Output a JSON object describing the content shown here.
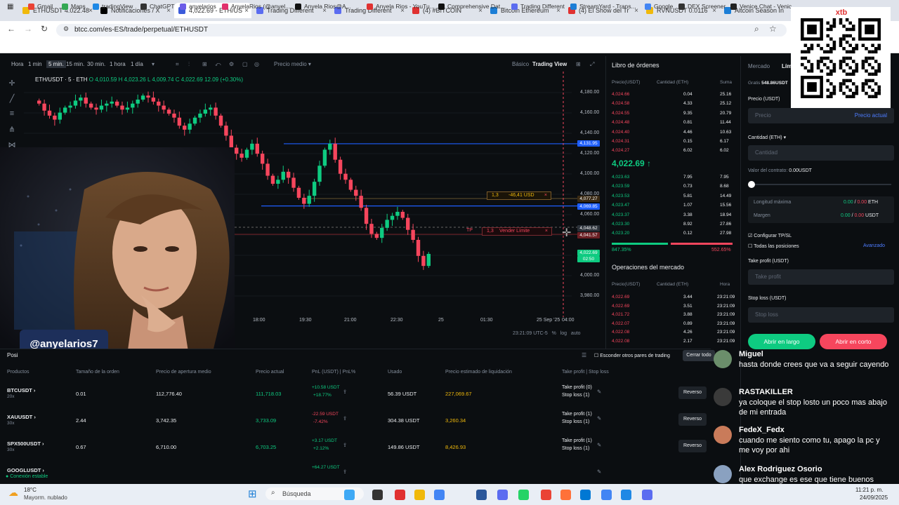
{
  "tabs": [
    {
      "label": "ETHUSDT 4.022.48",
      "color": "#f0b90b"
    },
    {
      "label": "Notificaciones / X",
      "color": "#000000"
    },
    {
      "label": "4,022.69 - ETH/US",
      "color": "#3b5bdb",
      "active": true
    },
    {
      "label": "Trading Different",
      "color": "#5b6cf0"
    },
    {
      "label": "Trading Different",
      "color": "#5b6cf0"
    },
    {
      "label": "(4) #BITCOIN",
      "color": "#e03131"
    },
    {
      "label": "Bitcoin Ethereum",
      "color": "#1c7ed6"
    },
    {
      "label": "(4) El Show del Tr",
      "color": "#e03131"
    },
    {
      "label": "RVNUSDT 0.0116",
      "color": "#f0b90b"
    },
    {
      "label": "Altcoin Season In",
      "color": "#1c7ed6"
    }
  ],
  "url": "btcc.com/es-ES/trade/perpetual/ETHUSDT",
  "bookmarks": [
    "Gmail",
    "Maps",
    "tradingView",
    "ChatGPT",
    "anyelarios",
    "AnyelaRios (@anyel...",
    "Anyela Rios@A...",
    "Anyela Rios - YouTu...",
    "Comprehensive Dat...",
    "Trading Different",
    "StreamYard - Trans...",
    "Google",
    "DEX Screener",
    "Venice Chat - Venic..."
  ],
  "chart_toolbar": {
    "interval_label": "Hora",
    "intervals": [
      "1 min",
      "5 min.",
      "15 min.",
      "30 min.",
      "1 hora",
      "1 día"
    ],
    "active_interval": "5 min.",
    "price_mode": "Precio medio",
    "view_basic": "Básico",
    "view_trading": "Trading View"
  },
  "symbol_line": {
    "symbol": "ETH/USDT · 5 · ETH",
    "o": "O 4,010.59",
    "h": "H 4,023.26",
    "l": "L 4,009.74",
    "c": "C 4,022.69",
    "chg": "12.09 (+0.30%)"
  },
  "price_scale": [
    "4,180.00",
    "4,160.00",
    "4,140.00",
    "4,120.00",
    "4,100.00",
    "4,080.00",
    "4,060.00",
    "4,040.00",
    "4,020.00",
    "4,000.00",
    "3,980.00"
  ],
  "price_tags": [
    {
      "v": "4,131.95",
      "c": "#1e5eff"
    },
    {
      "v": "4,077.27",
      "c": "#3a2a14"
    },
    {
      "v": "4,069.85",
      "c": "#1e5eff"
    },
    {
      "v": "4,048.62",
      "c": "#2b3139"
    },
    {
      "v": "4,041.57",
      "c": "#6b1f24"
    },
    {
      "v": "4,022.69",
      "c": "#0ecb81"
    },
    {
      "v": "02:50",
      "c": "#0ecb81"
    }
  ],
  "order_labels": {
    "sl": "1,3",
    "sl_val": "-46,41 USD",
    "tp": "TP",
    "tp_qty": "1,3",
    "tp_text": "Vender Límite"
  },
  "time_axis": [
    "18:00",
    "19:30",
    "21:00",
    "22:30",
    "25",
    "01:30",
    "25 Sep '25",
    "04:00"
  ],
  "chart_footer": {
    "clock": "23:21:09 UTC-5",
    "pct": "%",
    "log": "log",
    "auto": "auto"
  },
  "handle": "@anyelarios7",
  "orderbook": {
    "title": "Libro de órdenes",
    "cols": [
      "Precio(USDT)",
      "Cantidad (ETH)",
      "Suma"
    ],
    "asks": [
      [
        "4,024.66",
        "0.04",
        "25.16"
      ],
      [
        "4,024.58",
        "4.33",
        "25.12"
      ],
      [
        "4,024.55",
        "9.35",
        "20.79"
      ],
      [
        "4,024.48",
        "0.81",
        "11.44"
      ],
      [
        "4,024.40",
        "4.46",
        "10.63"
      ],
      [
        "4,024.31",
        "0.15",
        "6.17"
      ],
      [
        "4,024.27",
        "6.02",
        "6.02"
      ]
    ],
    "last": "4,022.69",
    "bids": [
      [
        "4,023.63",
        "7.95",
        "7.95"
      ],
      [
        "4,023.59",
        "0.73",
        "8.68"
      ],
      [
        "4,023.53",
        "5.81",
        "14.49"
      ],
      [
        "4,023.47",
        "1.07",
        "15.56"
      ],
      [
        "4,023.37",
        "3.38",
        "18.94"
      ],
      [
        "4,023.30",
        "8.92",
        "27.86"
      ],
      [
        "4,023.20",
        "0.12",
        "27.98"
      ]
    ],
    "buy_pct": "847.35%",
    "sell_pct": "552.65%",
    "trades_title": "Operaciones del mercado",
    "trades_cols": [
      "Precio(USDT)",
      "Cantidad (ETH)",
      "Hora"
    ],
    "trades": [
      [
        "4,022.69",
        "3.44",
        "23:21:09"
      ],
      [
        "4,022.69",
        "3.51",
        "23:21:09"
      ],
      [
        "4,021.72",
        "3.88",
        "23:21:09"
      ],
      [
        "4,022.07",
        "0.89",
        "23:21:09"
      ],
      [
        "4,022.08",
        "4.26",
        "23:21:09"
      ],
      [
        "4,022.08",
        "2.17",
        "23:21:09"
      ]
    ]
  },
  "trade_panel": {
    "tab_market": "Mercado",
    "tab_limit": "Lími",
    "grats": "Gratis",
    "balance": "548.86USDT",
    "price_label": "Precio (USDT)",
    "price_ph": "Precio",
    "price_current": "Precio actual",
    "qty_label": "Cantidad (ETH)",
    "qty_ph": "Cantidad",
    "contract_value": "Valor del contrato:",
    "contract_num": "0.00USDT",
    "max_len": "Longitud máxima",
    "max_len_v1": "0.00",
    "max_len_v2": "0.00",
    "max_len_unit": "ETH",
    "margin": "Margen",
    "margin_v1": "0.00",
    "margin_v2": "0.00",
    "margin_unit": "USDT",
    "cfg_tpsl": "Configurar TP/SL",
    "all_pos": "Todas las posiciones",
    "advanced": "Avanzado",
    "tp_label": "Take profit (USDT)",
    "tp_ph": "Take profit",
    "sl_label": "Stop loss (USDT)",
    "sl_ph": "Stop loss",
    "btn_long": "Abrir en largo",
    "btn_short": "Abrir en corto"
  },
  "positions": {
    "tab": "Posi",
    "hide_pairs": "Esconder otros pares de trading",
    "close_all": "Cerrar todo",
    "cols": [
      "Productos",
      "Tamaño de la orden",
      "Precio de apertura medio",
      "Precio actual",
      "PnL (USDT) | PnL%",
      "Usado",
      "Precio estimado de liquidación",
      "Take profit | Stop loss"
    ],
    "rows": [
      {
        "sym": "BTCUSDT",
        "lev": "20x",
        "size": "0.01",
        "open": "112,776.40",
        "cur": "111,718.03",
        "pnl": "+10.58 USDT",
        "pnlp": "+18.77%",
        "used": "56.39 USDT",
        "liq": "227,069.67",
        "tp": "Take profit (0)",
        "sl": "Stop loss (1)",
        "pos": true
      },
      {
        "sym": "XAUUSDT",
        "lev": "30x",
        "size": "2.44",
        "open": "3,742.35",
        "cur": "3,733.09",
        "pnl": "-22.59 USDT",
        "pnlp": "-7.42%",
        "used": "304.38 USDT",
        "liq": "3,260.34",
        "tp": "Take profit (1)",
        "sl": "Stop loss (1)",
        "pos": false
      },
      {
        "sym": "SPX500USDT",
        "lev": "30x",
        "size": "0.67",
        "open": "6,710.00",
        "cur": "6,703.25",
        "pnl": "+3.17 USDT",
        "pnlp": "+2.12%",
        "used": "149.86 USDT",
        "liq": "8,426.93",
        "tp": "Take profit (1)",
        "sl": "Stop loss (1)",
        "pos": true
      },
      {
        "sym": "GOOGLUSDT",
        "lev": "",
        "size": "",
        "open": "",
        "cur": "",
        "pnl": "+64.27 USDT",
        "pnlp": "",
        "used": "",
        "liq": "",
        "tp": "",
        "sl": "",
        "pos": true
      }
    ],
    "reverse": "Reverso",
    "conn": "Conexión estable"
  },
  "chat": [
    {
      "name": "Miguel",
      "text": "hasta donde crees que va a seguir cayendo",
      "color": "#6b8e6b"
    },
    {
      "name": "RASTAKILLER",
      "text": "ya coloque el stop losto un poco mas abajo de mi entrada",
      "color": "#3a3a3a"
    },
    {
      "name": "FedeX_Fedx",
      "text": "cuando me siento como tu, apago la pc y me voy por ahi",
      "color": "#c97b5a"
    },
    {
      "name": "Alex Rodriguez Osorio",
      "text": "que exchange es ese que tiene buenos",
      "color": "#8aa1c0"
    }
  ],
  "qr_brand": "xtb",
  "weather": {
    "temp": "18°C",
    "desc": "Mayorm. nublado"
  },
  "search": "Búsqueda",
  "clock": {
    "time": "11:21 p. m.",
    "date": "24/09/2025"
  },
  "colors": {
    "up": "#0ecb81",
    "down": "#f6465d",
    "bg": "#0b0e11",
    "accent": "#f0b90b"
  },
  "chart_data": {
    "type": "candlestick",
    "symbol": "ETH/USDT",
    "x_ticks": [
      "18:00",
      "19:30",
      "21:00",
      "22:30",
      "25",
      "01:30",
      "25 Sep '25",
      "04:00"
    ],
    "ylim": [
      3980,
      4190
    ],
    "closes": [
      4172,
      4165,
      4160,
      4156,
      4163,
      4168,
      4170,
      4175,
      4178,
      4172,
      4168,
      4166,
      4170,
      4172,
      4174,
      4170,
      4166,
      4168,
      4172,
      4176,
      4180,
      4178,
      4174,
      4170,
      4166,
      4162,
      4158,
      4150,
      4146,
      4152,
      4158,
      4162,
      4166,
      4168,
      4160,
      4150,
      4140,
      4128,
      4122,
      4118,
      4126,
      4132,
      4122,
      4112,
      4100,
      4092,
      4096,
      4104,
      4098,
      4088,
      4078,
      4072,
      4080,
      4094,
      4110,
      4126,
      4132,
      4116,
      4102,
      4096,
      4086,
      4080,
      4068,
      4052,
      4042,
      4038,
      4048,
      4056,
      4060,
      4064,
      4058,
      4046,
      4036,
      4020,
      4010,
      4022
    ]
  }
}
